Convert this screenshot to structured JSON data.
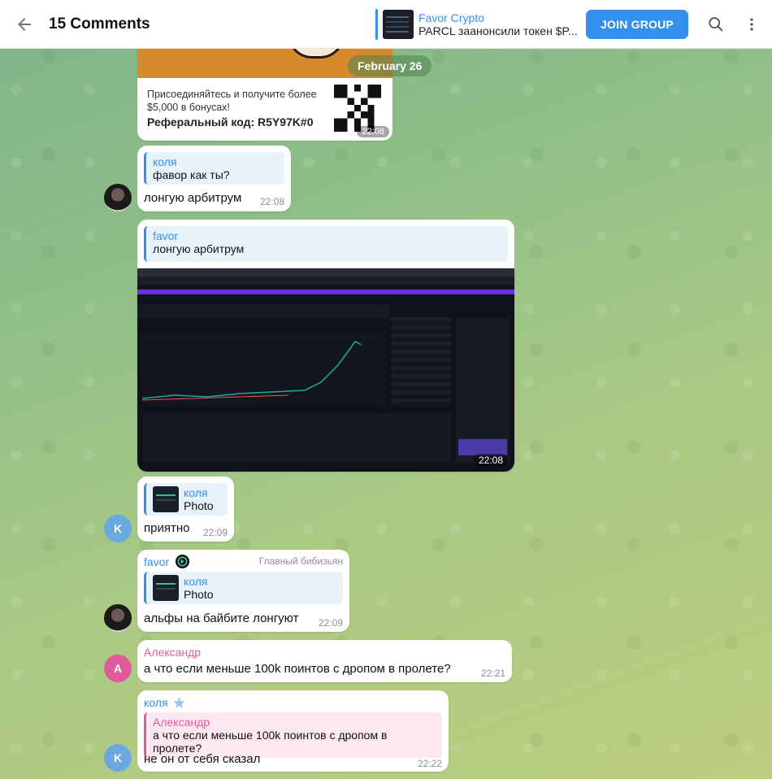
{
  "header": {
    "title": "15 Comments",
    "pinned_channel": "Favor Crypto",
    "pinned_message": "PARCL заанонсили токен $P...",
    "join_label": "JOIN GROUP"
  },
  "date_pill": "February 26",
  "ad_card": {
    "text": "Присоединяйтесь и получите более $5,000 в бонусах!",
    "code": "Реферальный код: R5Y97K#0",
    "time": "22:08"
  },
  "messages": [
    {
      "reply_name": "коля",
      "reply_text": "фавор как ты?",
      "text": "лонгую арбитрум",
      "time": "22:08"
    },
    {
      "reply_name": "favor",
      "reply_text": "лонгую арбитрум",
      "time": "22:08"
    },
    {
      "reply_name": "коля",
      "reply_text": "Photo",
      "text": "приятно",
      "time": "22:09",
      "avatar_letter": "K"
    },
    {
      "sender": "favor",
      "rank": "Главный бибизьян",
      "reply_name": "коля",
      "reply_text": "Photo",
      "text": "альфы на байбите лонгуют",
      "time": "22:09"
    },
    {
      "sender": "Александр",
      "text": "а что если меньше 100k поинтов с дропом в пролете?",
      "time": "22:21",
      "avatar_letter": "A"
    },
    {
      "sender": "коля",
      "reply_name": "Александр",
      "reply_text": "а что если меньше 100k поинтов с дропом в пролете?",
      "text": "не он от себя сказал",
      "time": "22:22",
      "avatar_letter": "K"
    }
  ],
  "colors": {
    "accent": "#3390ec",
    "alexandr": "#e05a9b",
    "kolya_avatar": "#6aa9e0"
  },
  "icons": [
    "back-arrow-icon",
    "search-icon",
    "more-vertical-icon",
    "star-icon",
    "qr-code-icon"
  ]
}
